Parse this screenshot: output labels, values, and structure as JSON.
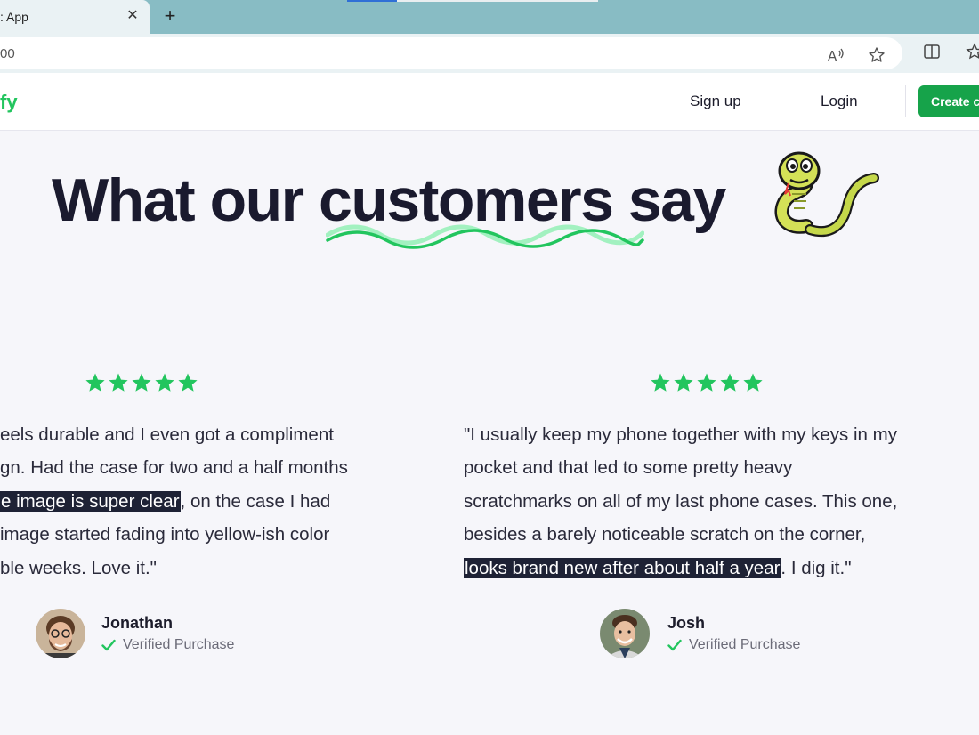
{
  "browser": {
    "tab_title": ": App",
    "tab_close": "✕",
    "new_tab": "+",
    "url": "00"
  },
  "nav": {
    "logo": "fy",
    "signup": "Sign up",
    "login": "Login",
    "create": "Create c"
  },
  "heading": {
    "part1": "What our ",
    "highlight": "customers",
    "part2": " say"
  },
  "reviews": [
    {
      "stars": 5,
      "lines": [
        "eels durable and I even got a compliment",
        "gn. Had the case for two and a half months"
      ],
      "line3_mark": "e image is super clear",
      "line3_rest": ", on the case I had",
      "lines_after": [
        "image started fading into yellow-ish color",
        "ble weeks. Love it.\""
      ],
      "name": "Jonathan",
      "verified": "Verified Purchase"
    },
    {
      "stars": 5,
      "lines": [
        "\"I usually keep my phone together with my keys in my",
        "pocket and that led to some pretty heavy",
        "scratchmarks on all of my last phone cases. This one,",
        "besides a barely noticeable scratch on the corner,"
      ],
      "line5_mark": "looks brand new after about half a year",
      "line5_rest": ". I dig it.\"",
      "name": "Josh",
      "verified": "Verified Purchase"
    }
  ],
  "colors": {
    "accent": "#22c55e",
    "button": "#16a34a",
    "highlight_bg": "#1e2235"
  }
}
